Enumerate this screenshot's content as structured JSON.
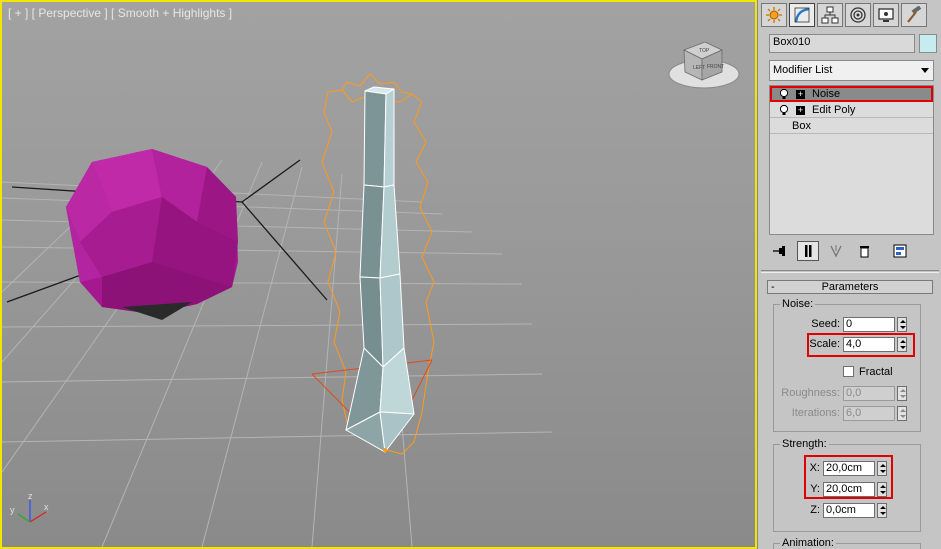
{
  "viewport": {
    "label": "[ + ] [ Perspective ] [ Smooth + Highlights ]",
    "viewcube_labels": [
      "LEFT",
      "FRONT",
      "TOP"
    ],
    "axis_labels": {
      "x": "x",
      "y": "y",
      "z": "z"
    },
    "colors": {
      "border": "#f2e500",
      "gizmo_orange": "#ff9a1a",
      "object_magenta": "#b0209a",
      "object_teal": "#a9c7c9"
    }
  },
  "panel": {
    "tabs": [
      {
        "name": "create",
        "icon": "sun-icon",
        "active": false
      },
      {
        "name": "modify",
        "icon": "modify-icon",
        "active": true
      },
      {
        "name": "hierarchy",
        "icon": "hierarchy-icon",
        "active": false
      },
      {
        "name": "motion",
        "icon": "motion-icon",
        "active": false
      },
      {
        "name": "display",
        "icon": "display-icon",
        "active": false
      },
      {
        "name": "utilities",
        "icon": "hammer-icon",
        "active": false
      }
    ],
    "object_name": "Box010",
    "object_color": "#c7ecef",
    "modifier_list": "Modifier List",
    "stack": [
      {
        "label": "Noise",
        "bulb": true,
        "plus": true,
        "selected": true
      },
      {
        "label": "Edit Poly",
        "bulb": true,
        "plus": true,
        "selected": false
      },
      {
        "label": "Box",
        "bulb": false,
        "plus": false,
        "selected": false
      }
    ],
    "parameters": {
      "rollout_title": "Parameters",
      "rollout_toggle": "-",
      "noise_group": "Noise:",
      "seed_label": "Seed:",
      "seed_value": "0",
      "scale_label": "Scale:",
      "scale_value": "4,0",
      "fractal_label": "Fractal",
      "roughness_label": "Roughness:",
      "roughness_value": "0,0",
      "iterations_label": "Iterations:",
      "iterations_value": "6,0",
      "strength_group": "Strength:",
      "x_label": "X:",
      "x_value": "20,0cm",
      "y_label": "Y:",
      "y_value": "20,0cm",
      "z_label": "Z:",
      "z_value": "0,0cm",
      "animation_group": "Animation:"
    },
    "highlight_color": "#e00000"
  }
}
